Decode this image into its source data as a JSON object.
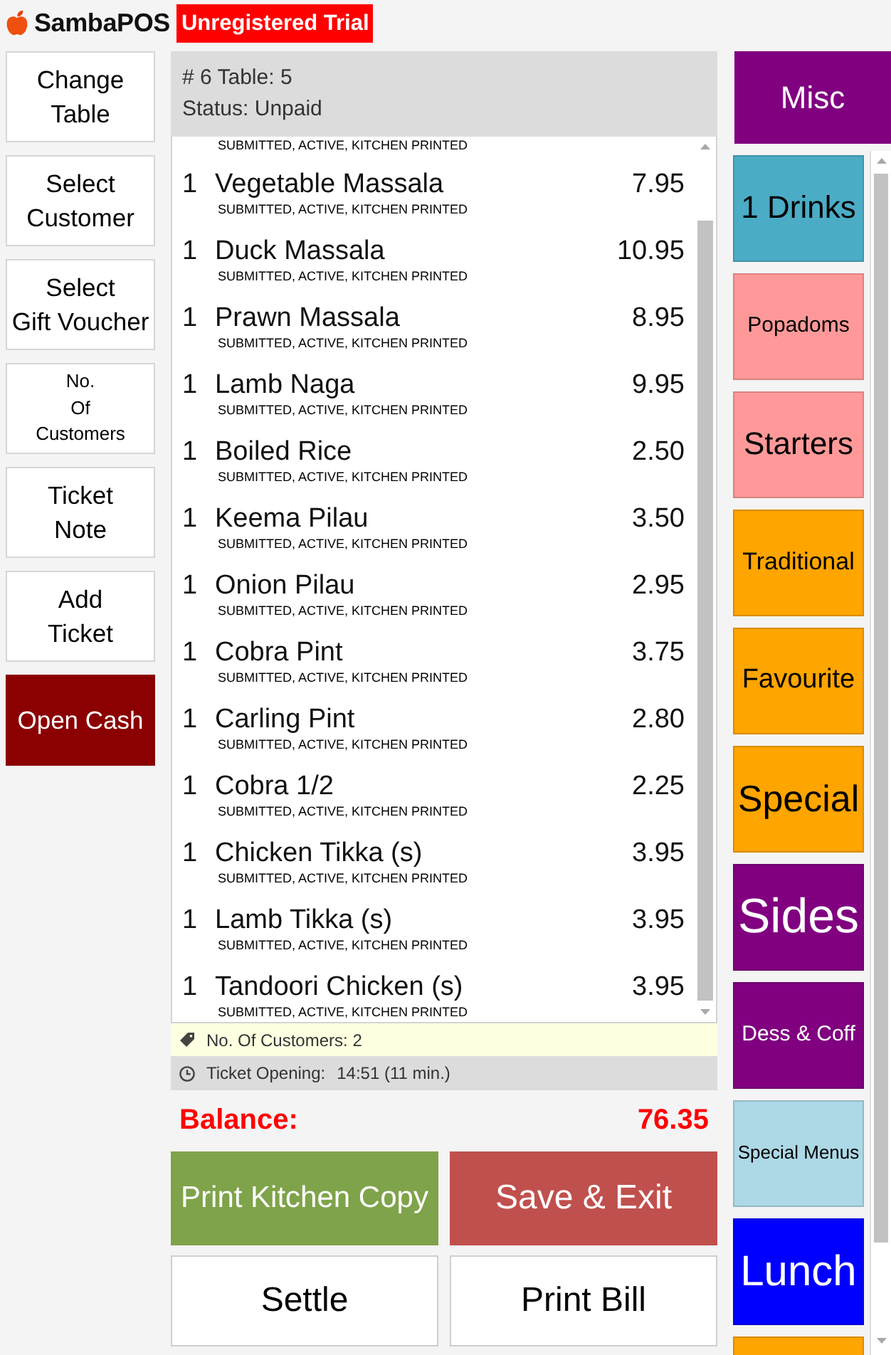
{
  "app_bar": {
    "logo_text": "SambaPOS",
    "badge": "Unregistered Trial"
  },
  "actions": [
    {
      "label": "Change\nTable",
      "kind": "plain"
    },
    {
      "label": "Select\nCustomer",
      "kind": "plain"
    },
    {
      "label": "Select\nGift Voucher",
      "kind": "plain"
    },
    {
      "label": "No.\nOf\nCustomers",
      "kind": "compact"
    },
    {
      "label": "Ticket\nNote",
      "kind": "plain"
    },
    {
      "label": "Add\nTicket",
      "kind": "plain"
    },
    {
      "label": "Open Cash",
      "kind": "alert"
    }
  ],
  "ticket": {
    "number": "# 6 Table: 5",
    "status": "Status: Unpaid",
    "orders": [
      {
        "status": "SUBMITTED, ACTIVE, KITCHEN PRINTED"
      },
      {
        "quantity": "1",
        "name": "Vegetable Massala",
        "price": "7.95",
        "status": "SUBMITTED, ACTIVE, KITCHEN PRINTED"
      },
      {
        "quantity": "1",
        "name": "Duck Massala",
        "price": "10.95",
        "status": "SUBMITTED, ACTIVE, KITCHEN PRINTED"
      },
      {
        "quantity": "1",
        "name": "Prawn Massala",
        "price": "8.95",
        "status": "SUBMITTED, ACTIVE, KITCHEN PRINTED"
      },
      {
        "quantity": "1",
        "name": "Lamb Naga",
        "price": "9.95",
        "status": "SUBMITTED, ACTIVE, KITCHEN PRINTED"
      },
      {
        "quantity": "1",
        "name": "Boiled Rice",
        "price": "2.50",
        "status": "SUBMITTED, ACTIVE, KITCHEN PRINTED"
      },
      {
        "quantity": "1",
        "name": "Keema Pilau",
        "price": "3.50",
        "status": "SUBMITTED, ACTIVE, KITCHEN PRINTED"
      },
      {
        "quantity": "1",
        "name": "Onion Pilau",
        "price": "2.95",
        "status": "SUBMITTED, ACTIVE, KITCHEN PRINTED"
      },
      {
        "quantity": "1",
        "name": "Cobra Pint",
        "price": "3.75",
        "status": "SUBMITTED, ACTIVE, KITCHEN PRINTED"
      },
      {
        "quantity": "1",
        "name": "Carling Pint",
        "price": "2.80",
        "status": "SUBMITTED, ACTIVE, KITCHEN PRINTED"
      },
      {
        "quantity": "1",
        "name": "Cobra 1/2",
        "price": "2.25",
        "status": "SUBMITTED, ACTIVE, KITCHEN PRINTED"
      },
      {
        "quantity": "1",
        "name": "Chicken Tikka (s)",
        "price": "3.95",
        "status": "SUBMITTED, ACTIVE, KITCHEN PRINTED"
      },
      {
        "quantity": "1",
        "name": "Lamb Tikka (s)",
        "price": "3.95",
        "status": "SUBMITTED, ACTIVE, KITCHEN PRINTED"
      },
      {
        "quantity": "1",
        "name": "Tandoori Chicken (s)",
        "price": "3.95",
        "status": "SUBMITTED, ACTIVE, KITCHEN PRINTED"
      }
    ],
    "tags": [
      {
        "kind": "note",
        "text": "No. Of Customers: 2"
      },
      {
        "kind": "time",
        "label": "Ticket Opening:",
        "value": "14:51 (11 min.)"
      }
    ],
    "balance_label": "Balance:",
    "balance": "76.35"
  },
  "ticket_buttons": [
    {
      "label": "Print Kitchen Copy",
      "color": "#7fa34a"
    },
    {
      "label": "Save & Exit",
      "color": "#c0504d"
    },
    {
      "label": "Settle",
      "color": "#ffffff"
    },
    {
      "label": "Print Bill",
      "color": "#ffffff"
    }
  ],
  "categories": {
    "pinned": {
      "label": "Misc",
      "color": "#800080"
    },
    "items": [
      {
        "label": "1 Drinks",
        "color": "#4bacc6"
      },
      {
        "label": "Popadoms",
        "color": "#ff9999"
      },
      {
        "label": "Starters",
        "color": "#ff9999"
      },
      {
        "label": "Traditional",
        "color": "#ffa500"
      },
      {
        "label": "Favourite",
        "color": "#ffa500"
      },
      {
        "label": "Special",
        "color": "#ffa500"
      },
      {
        "label": "Sides",
        "color": "#800080"
      },
      {
        "label": "Dess & Coff",
        "color": "#800080"
      },
      {
        "label": "Special Menus",
        "color": "#add8e6"
      },
      {
        "label": "Lunch",
        "color": "#0000ff"
      },
      {
        "color": "#ffa500"
      }
    ]
  }
}
